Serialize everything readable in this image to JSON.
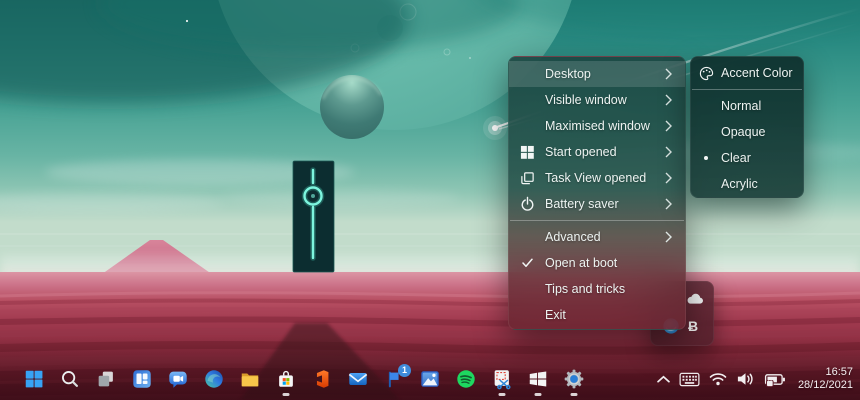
{
  "context_menu": {
    "items": [
      {
        "label": "Desktop",
        "has_submenu": true,
        "highlighted": true
      },
      {
        "label": "Visible window",
        "has_submenu": true
      },
      {
        "label": "Maximised window",
        "has_submenu": true
      },
      {
        "label": "Start opened",
        "icon": "windows-logo-icon",
        "has_submenu": true
      },
      {
        "label": "Task View opened",
        "icon": "task-view-icon",
        "has_submenu": true
      },
      {
        "label": "Battery saver",
        "icon": "battery-saver-icon",
        "has_submenu": true
      },
      {
        "label": "Advanced",
        "has_submenu": true
      },
      {
        "label": "Open at boot",
        "icon": "checkmark-icon",
        "checked": true
      },
      {
        "label": "Tips and tricks"
      },
      {
        "label": "Exit"
      }
    ]
  },
  "submenu": {
    "items": [
      {
        "label": "Accent Color",
        "icon": "palette-icon"
      },
      {
        "label": "Normal"
      },
      {
        "label": "Opaque"
      },
      {
        "label": "Clear",
        "selected": true
      },
      {
        "label": "Acrylic"
      }
    ]
  },
  "taskbar": {
    "alignment": "left",
    "mode": "clear-transparent",
    "pinned_icons": [
      {
        "name": "start"
      },
      {
        "name": "search"
      },
      {
        "name": "task-view"
      },
      {
        "name": "widgets"
      },
      {
        "name": "chat"
      },
      {
        "name": "edge"
      },
      {
        "name": "file-explorer"
      },
      {
        "name": "microsoft-store",
        "running": true
      },
      {
        "name": "office"
      },
      {
        "name": "mail"
      },
      {
        "name": "flag-notification",
        "badge": "1"
      },
      {
        "name": "photos"
      },
      {
        "name": "spotify"
      },
      {
        "name": "snipping-tool",
        "running": true
      },
      {
        "name": "windows-app",
        "running": true
      },
      {
        "name": "settings",
        "running": true
      }
    ],
    "badge": "1",
    "tray_icons": [
      "hidden-icons-chevron",
      "touch-keyboard",
      "wifi",
      "volume",
      "battery-charging"
    ],
    "clock": {
      "time": "16:57",
      "date": "28/12/2021"
    }
  },
  "tray_flyout": {
    "icons": [
      "onedrive-cloud-icon",
      "translucenttb-icon",
      "b-app-icon"
    ],
    "b_glyph": "Ƀ"
  },
  "colors": {
    "sky_teal": "#47a294",
    "ground_red": "#8c2c3f",
    "menu_tint_top": "#193e3a",
    "menu_tint_bottom": "#6c2632",
    "menu_highlight": "rgba(255,255,255,0.14)",
    "menu_text": "#edf3f1",
    "monolith_glow": "#6ff2dc",
    "badge_blue": "#3f8cdb"
  }
}
